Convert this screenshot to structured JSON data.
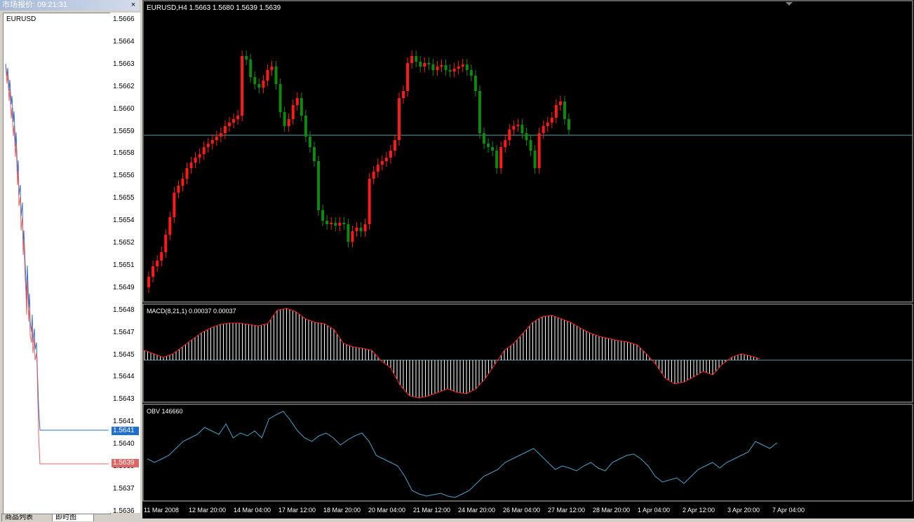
{
  "market_watch": {
    "title": "市场报价: 09:21:31",
    "close_glyph": "×",
    "symbol": "EURUSD",
    "price_labels": [
      "1.5666",
      "1.5664",
      "1.5663",
      "1.5662",
      "1.5660",
      "1.5659",
      "1.5658",
      "1.5656",
      "1.5655",
      "1.5654",
      "1.5652",
      "1.5651",
      "1.5649",
      "1.5648",
      "1.5647",
      "1.5645",
      "1.5644",
      "1.5643",
      "1.5641",
      "1.5640",
      "1.5639",
      "1.5637",
      "1.5636"
    ],
    "ask_price": "1.5641",
    "bid_price": "1.5639",
    "ask_color": "#1f6fd1",
    "bid_color": "#e06666",
    "tabs": [
      "商品列表",
      "即时图"
    ]
  },
  "main_chart": {
    "header": "EURUSD,H4  1.5663 1.5680 1.5639 1.5639",
    "bull_color": "#0d8a0d",
    "bear_color": "#ff1a1a",
    "x_labels": [
      "11 Mar 2008",
      "12 Mar 20:00",
      "14 Mar 04:00",
      "17 Mar 12:00",
      "18 Mar 20:00",
      "20 Mar 04:00",
      "21 Mar 12:00",
      "24 Mar 20:00",
      "26 Mar 04:00",
      "27 Mar 12:00",
      "28 Mar 20:00",
      "1 Apr 04:00",
      "2 Apr 12:00",
      "3 Apr 20:00",
      "7 Apr 04:00"
    ]
  },
  "macd": {
    "label": "MACD(8,21,1) 0.00037 0.00037"
  },
  "obv": {
    "label": "OBV 146660",
    "line_color": "#4aa3c8"
  }
}
